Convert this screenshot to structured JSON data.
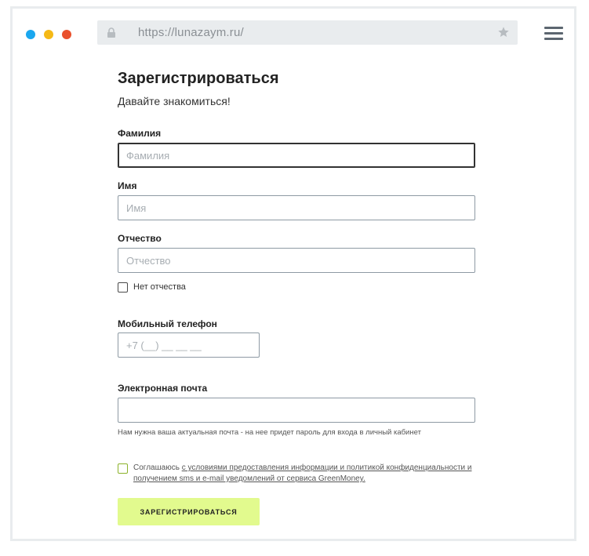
{
  "browser": {
    "url": "https://lunazaym.ru/",
    "dot_colors": [
      "#1aa7ef",
      "#f5b916",
      "#e9502c"
    ]
  },
  "form": {
    "title": "Зарегистрироваться",
    "subtitle": "Давайте знакомиться!",
    "fields": {
      "surname": {
        "label": "Фамилия",
        "placeholder": "Фамилия",
        "value": ""
      },
      "name": {
        "label": "Имя",
        "placeholder": "Имя",
        "value": ""
      },
      "patronymic": {
        "label": "Отчество",
        "placeholder": "Отчество",
        "value": ""
      },
      "phone": {
        "label": "Мобильный телефон",
        "placeholder": "+7 (__) __ __ __",
        "value": ""
      },
      "email": {
        "label": "Электронная почта",
        "placeholder": "",
        "value": ""
      }
    },
    "no_patronymic_label": "Нет отчества",
    "email_hint": "Нам нужна ваша актуальная почта - на нее придет пароль для входа в личный кабинет",
    "consent": {
      "prefix": "Соглашаюсь ",
      "link_text": "с условиями предоставления информации и политикой конфиденциальности и получением sms и e-mail уведомлений от сервиса GreenMoney."
    },
    "submit_label": "ЗАРЕГИСТРИРОВАТЬСЯ",
    "accent_color": "#e2fa8e"
  }
}
